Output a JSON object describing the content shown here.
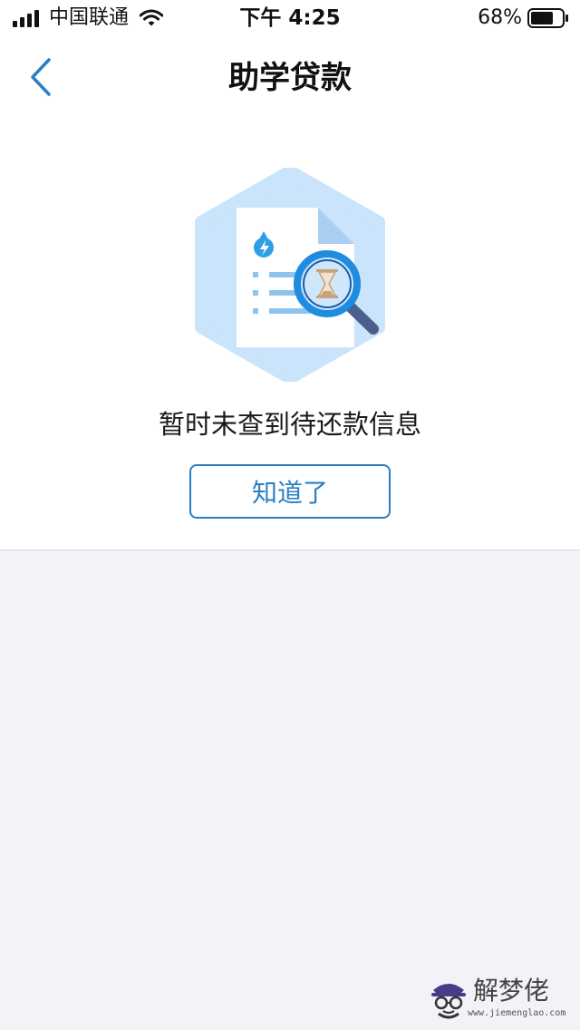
{
  "status_bar": {
    "carrier": "中国联通",
    "time": "下午 4:25",
    "battery": "68%",
    "icons": [
      "signal-icon",
      "wifi-icon",
      "battery-icon"
    ]
  },
  "nav": {
    "title": "助学贷款",
    "back_icon": "chevron-left-icon"
  },
  "empty_state": {
    "illustration": "document-search-illustration",
    "message": "暂时未查到待还款信息",
    "button_label": "知道了"
  },
  "watermark": {
    "brand": "解梦佬",
    "url": "www.jiemenglao.com"
  },
  "colors": {
    "accent": "#2a7fc4",
    "page_background": "#f2f2f7",
    "card_background": "#ffffff"
  }
}
